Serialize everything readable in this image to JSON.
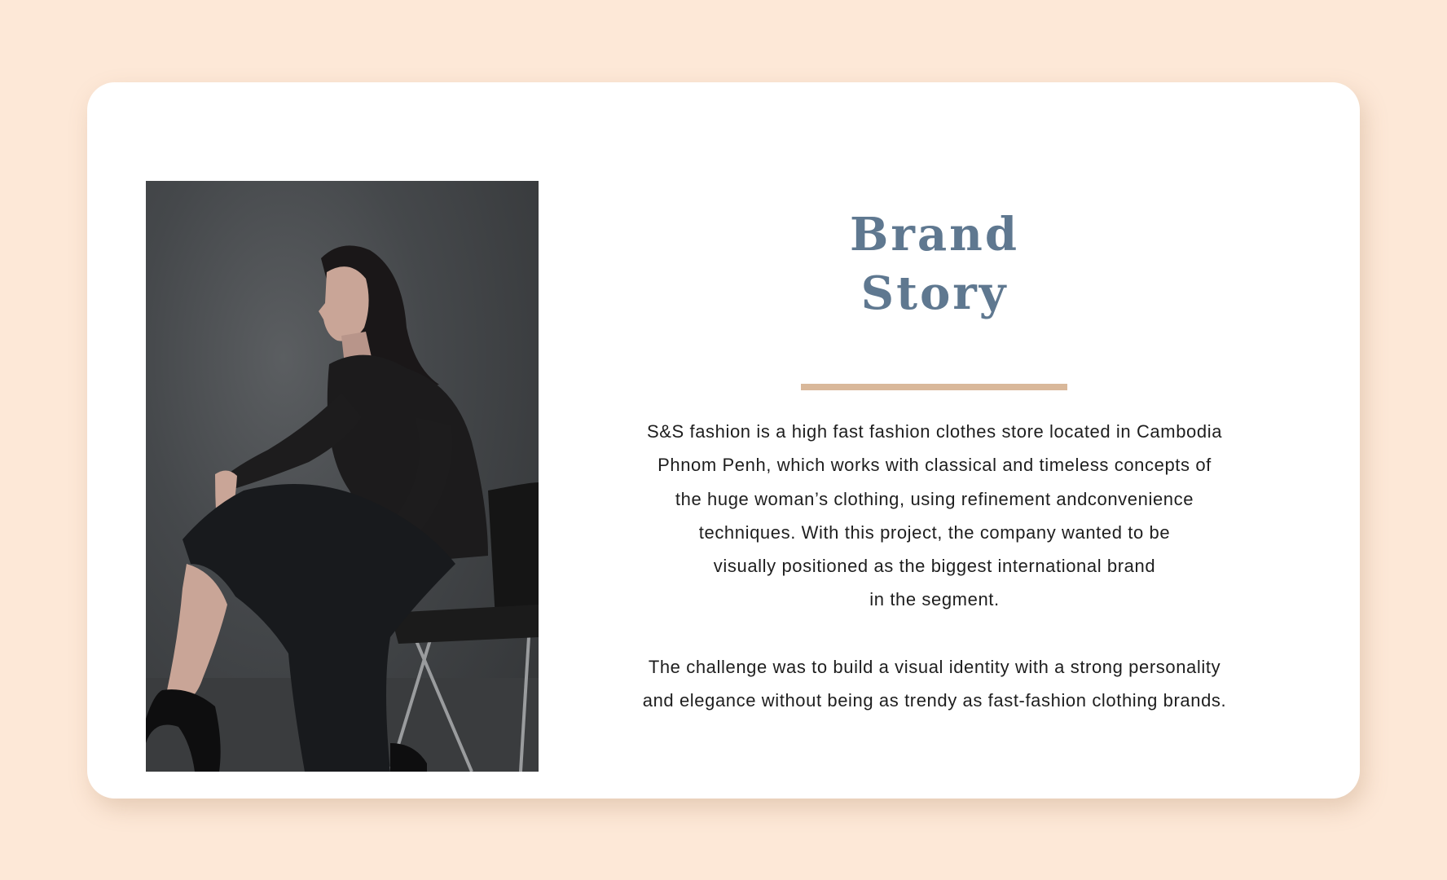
{
  "title": {
    "line1": "Brand",
    "line2": "Story"
  },
  "paragraphs": [
    {
      "lines": [
        "S&S fashion is a high fast fashion clothes store located in Cambodia",
        "Phnom Penh, which works with classical and timeless concepts of",
        "the huge woman’s clothing, using refinement andconvenience",
        "techniques. With this project, the company wanted to be",
        "visually positioned as the biggest international brand",
        "in the segment."
      ]
    },
    {
      "lines": [
        "The challenge was to build a visual identity with a strong personality",
        "and elegance without being as trendy as fast-fashion clothing brands."
      ]
    }
  ],
  "colors": {
    "background": "#fde8d7",
    "card": "#ffffff",
    "title": "#5f7890",
    "accent_rule": "#d9b89a",
    "body_text": "#1e1e1e"
  }
}
